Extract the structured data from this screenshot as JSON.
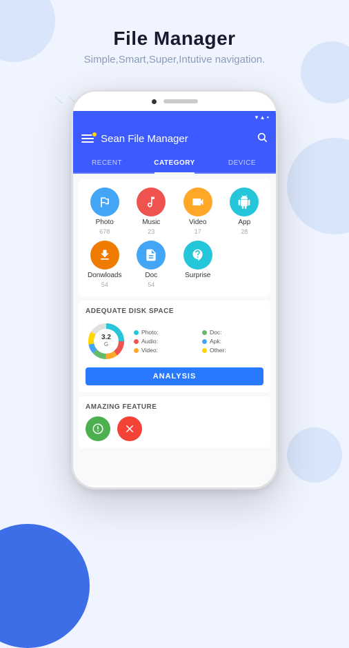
{
  "header": {
    "title": "File Manager",
    "subtitle": "Simple,Smart,Super,Intutive navigation."
  },
  "app": {
    "name": "Sean File Manager",
    "tabs": [
      {
        "label": "RECENT",
        "active": false
      },
      {
        "label": "CATEGORY",
        "active": true
      },
      {
        "label": "DEVICE",
        "active": false
      }
    ]
  },
  "categories": [
    {
      "label": "Photo",
      "count": "678",
      "color": "#42a5f5",
      "icon": "🏔"
    },
    {
      "label": "Music",
      "count": "23",
      "color": "#ef5350",
      "icon": "🎵"
    },
    {
      "label": "Video",
      "count": "17",
      "color": "#ffa726",
      "icon": "🎬"
    },
    {
      "label": "App",
      "count": "28",
      "color": "#26c6da",
      "icon": "🤖"
    },
    {
      "label": "Donwloads",
      "count": "54",
      "color": "#ef7c00",
      "icon": "⬇"
    },
    {
      "label": "Doc",
      "count": "54",
      "color": "#42a5f5",
      "icon": "📄"
    },
    {
      "label": "Surprise",
      "count": "",
      "color": "#26c6da",
      "icon": "✦"
    }
  ],
  "disk": {
    "title": "ADEQUATE DISK SPACE",
    "value": "3.2",
    "unit": "G",
    "legend": [
      {
        "label": "Photo:",
        "color": "#26c6da"
      },
      {
        "label": "Doc:",
        "color": "#66bb6a"
      },
      {
        "label": "Audio:",
        "color": "#ef5350"
      },
      {
        "label": "Apk:",
        "color": "#42a5f5"
      },
      {
        "label": "Video:",
        "color": "#ffa726"
      },
      {
        "label": "Other:",
        "color": "#ffd600"
      }
    ],
    "analysis_btn": "ANALYSIS"
  },
  "feature": {
    "title": "AMAZING FEATURE",
    "icons": [
      {
        "color": "#4caf50"
      },
      {
        "color": "#f44336"
      }
    ]
  },
  "status_bar": {
    "wifi": "▲",
    "signal": "▲",
    "battery": "▪"
  }
}
